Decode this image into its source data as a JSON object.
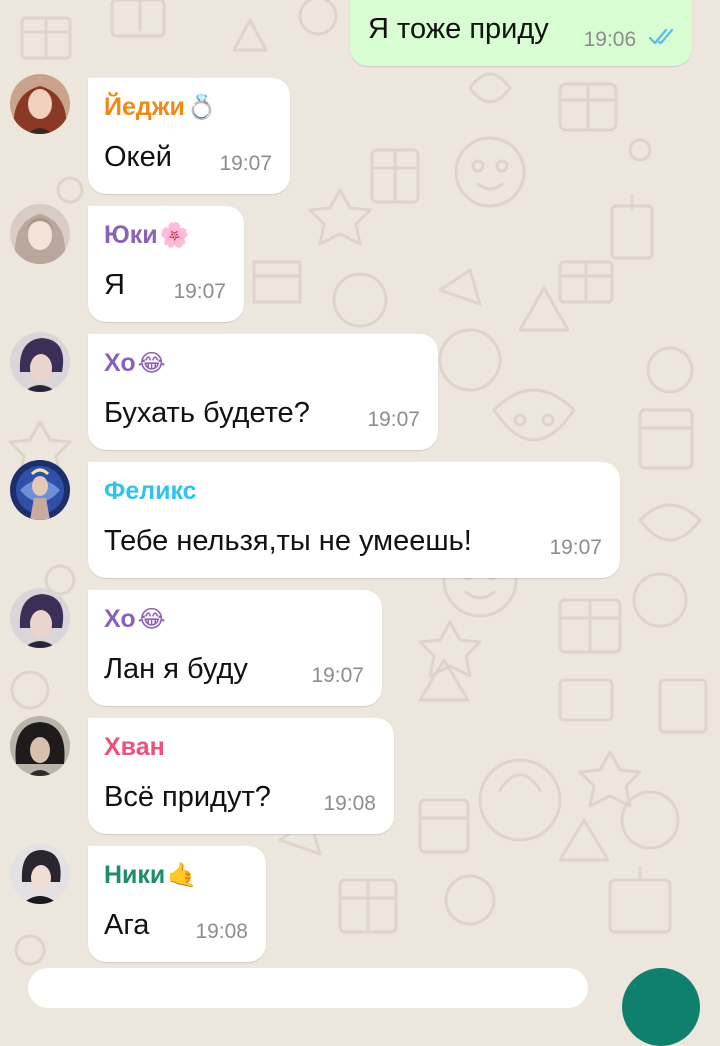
{
  "colors": {
    "background": "#ece6dd",
    "incoming_bubble": "#ffffff",
    "outgoing_bubble": "#d9fdd3",
    "time": "#8d8d8d",
    "read_ticks": "#53bdeb",
    "send_button": "#0f7f6e"
  },
  "messages": [
    {
      "direction": "outgoing",
      "text": "Я тоже приду",
      "time": "19:06",
      "status_icon": "double-check-read-icon"
    },
    {
      "direction": "incoming",
      "sender": "Йеджи",
      "sender_emoji": "💍",
      "sender_color": "#ef8a14",
      "avatar": "avatar-yeji",
      "text": "Окей",
      "time": "19:07"
    },
    {
      "direction": "incoming",
      "sender": "Юки",
      "sender_emoji": "🌸",
      "sender_color": "#8b63b5",
      "avatar": "avatar-yuki",
      "text": "Я",
      "time": "19:07"
    },
    {
      "direction": "incoming",
      "sender": "Хо",
      "sender_emoji": "😂",
      "sender_color": "#8b63b5",
      "avatar": "avatar-ho",
      "text": "Бухать будете?",
      "time": "19:07"
    },
    {
      "direction": "incoming",
      "sender": "Феликс",
      "sender_emoji": "",
      "sender_color": "#2ec4f0",
      "avatar": "avatar-felix",
      "text": "Тебе нельзя,ты не умеешь!",
      "time": "19:07"
    },
    {
      "direction": "incoming",
      "sender": "Хо",
      "sender_emoji": "😂",
      "sender_color": "#8b63b5",
      "avatar": "avatar-ho",
      "text": "Лан я буду",
      "time": "19:07"
    },
    {
      "direction": "incoming",
      "sender": "Хван",
      "sender_emoji": "",
      "sender_color": "#ef4f7b",
      "avatar": "avatar-hwang",
      "text": "Всё придут?",
      "time": "19:08"
    },
    {
      "direction": "incoming",
      "sender": "Ники",
      "sender_emoji": "🤙",
      "sender_color": "#1f8c6c",
      "avatar": "avatar-niki",
      "text": "Ага",
      "time": "19:08"
    }
  ]
}
